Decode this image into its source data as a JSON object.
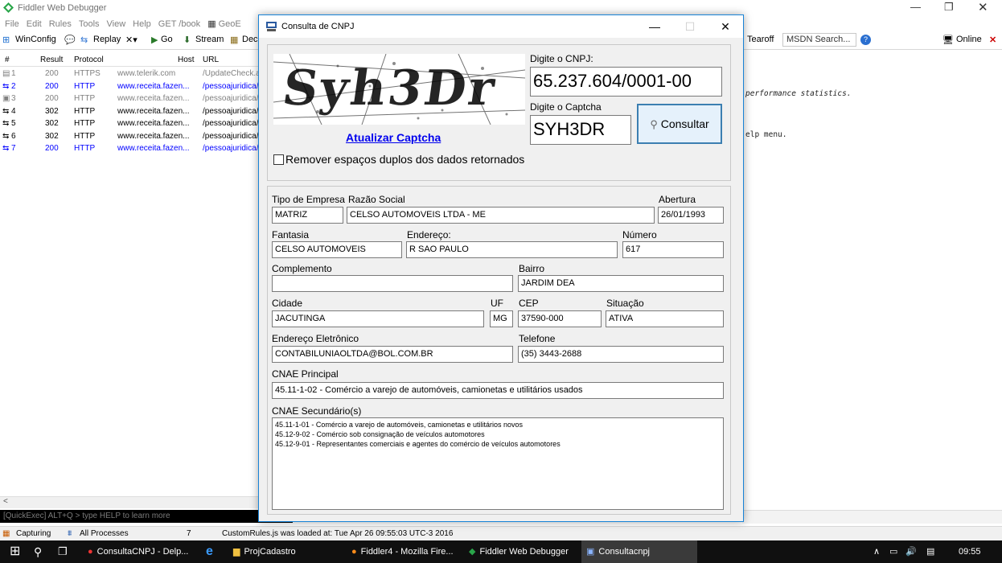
{
  "fiddler": {
    "title": "Fiddler Web Debugger",
    "menu": [
      "File",
      "Edit",
      "Rules",
      "Tools",
      "View",
      "Help",
      "GET /book",
      "GeoE"
    ],
    "toolbar": {
      "winconfig": "WinConfig",
      "replay": "Replay",
      "go": "Go",
      "stream": "Stream",
      "decode": "Deco",
      "tearoff": "Tearoff",
      "msdn_search": "MSDN Search...",
      "online": "Online"
    },
    "columns": [
      "#",
      "Result",
      "Protocol",
      "Host",
      "URL"
    ],
    "sessions": [
      {
        "num": "1",
        "result": "200",
        "protocol": "HTTPS",
        "host": "www.telerik.com",
        "url": "/UpdateCheck.a",
        "color": "#808080"
      },
      {
        "num": "2",
        "result": "200",
        "protocol": "HTTP",
        "host": "www.receita.fazen...",
        "url": "/pessoajuridica/",
        "color": "#0000ff"
      },
      {
        "num": "3",
        "result": "200",
        "protocol": "HTTP",
        "host": "www.receita.fazen...",
        "url": "/pessoajuridica/",
        "color": "#808080"
      },
      {
        "num": "4",
        "result": "302",
        "protocol": "HTTP",
        "host": "www.receita.fazen...",
        "url": "/pessoajuridica/",
        "color": "#000000"
      },
      {
        "num": "5",
        "result": "302",
        "protocol": "HTTP",
        "host": "www.receita.fazen...",
        "url": "/pessoajuridica/",
        "color": "#000000"
      },
      {
        "num": "6",
        "result": "302",
        "protocol": "HTTP",
        "host": "www.receita.fazen...",
        "url": "/pessoajuridica/",
        "color": "#000000"
      },
      {
        "num": "7",
        "result": "200",
        "protocol": "HTTP",
        "host": "www.receita.fazen...",
        "url": "/pessoajuridica/",
        "color": "#0000ff"
      }
    ],
    "right_text_1": "performance statistics.",
    "right_text_2": "elp menu.",
    "quickexec": "[QuickExec] ALT+Q > type HELP to learn more",
    "status": {
      "capturing": "Capturing",
      "processes": "All Processes",
      "count": "7",
      "message": "CustomRules.js was loaded at: Tue Apr 26 09:55:03 UTC-3 2016"
    }
  },
  "dialog": {
    "title": "Consulta de CNPJ",
    "captcha_image_text": "Syh3Dr",
    "refresh_captcha": "Atualizar Captcha",
    "cnpj_label": "Digite o CNPJ:",
    "cnpj_value": "65.237.604/0001-00",
    "captcha_label": "Digite o Captcha",
    "captcha_value": "SYH3DR",
    "consult_button": "Consultar",
    "remove_spaces": "Remover espaços duplos dos dados retornados",
    "fields": {
      "tipo_label": "Tipo de Empresa",
      "tipo": "MATRIZ",
      "razao_label": "Razão Social",
      "razao": "CELSO AUTOMOVEIS LTDA - ME",
      "abertura_label": "Abertura",
      "abertura": "26/01/1993",
      "fantasia_label": "Fantasia",
      "fantasia": "CELSO AUTOMOVEIS",
      "endereco_label": "Endereço:",
      "endereco": "R SAO PAULO",
      "numero_label": "Número",
      "numero": "617",
      "complemento_label": "Complemento",
      "complemento": "",
      "bairro_label": "Bairro",
      "bairro": "JARDIM DEA",
      "cidade_label": "Cidade",
      "cidade": "JACUTINGA",
      "uf_label": "UF",
      "uf": "MG",
      "cep_label": "CEP",
      "cep": "37590-000",
      "situacao_label": "Situação",
      "situacao": "ATIVA",
      "email_label": "Endereço Eletrônico",
      "email": "CONTABILUNIAOLTDA@BOL.COM.BR",
      "telefone_label": "Telefone",
      "telefone": "(35) 3443-2688",
      "cnae_principal_label": "CNAE Principal",
      "cnae_principal": "45.11-1-02 - Comércio a varejo de automóveis, camionetas e utilitários usados",
      "cnae_secundarios_label": "CNAE Secundário(s)",
      "cnae_secundarios": [
        "45.11-1-01 - Comércio a varejo de automóveis, camionetas e utilitários novos",
        "45.12-9-02 - Comércio sob consignação de veículos automotores",
        "45.12-9-01 - Representantes comerciais e agentes do comércio de veículos automotores"
      ]
    }
  },
  "taskbar": {
    "items": [
      "ConsultaCNPJ - Delp...",
      "ProjCadastro",
      "Fiddler4 - Mozilla Fire...",
      "Fiddler Web Debugger",
      "Consultacnpj"
    ],
    "clock": "09:55"
  },
  "colors": {
    "accent": "#1883d7",
    "link": "#0000ee",
    "taskbar": "#101010"
  }
}
